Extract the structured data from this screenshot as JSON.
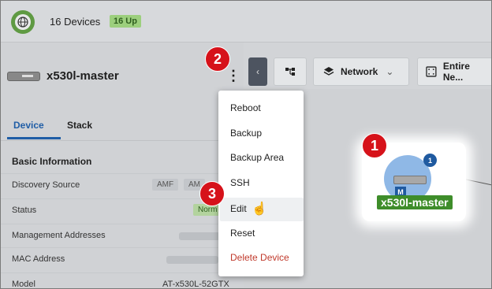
{
  "topbar": {
    "device_count": "16 Devices",
    "up_badge": "16 Up"
  },
  "device_panel": {
    "device_name": "x530l-master",
    "tabs": [
      "Device",
      "Stack"
    ],
    "section_title": "Basic Information",
    "rows": [
      {
        "label": "Discovery Source",
        "chips": [
          "AMF",
          "AM"
        ]
      },
      {
        "label": "Status",
        "chip": "Norm"
      },
      {
        "label": "Management Addresses"
      },
      {
        "label": "MAC Address"
      },
      {
        "label": "Model",
        "value": "AT-x530L-52GTX"
      }
    ]
  },
  "toolbar": {
    "network_label": "Network",
    "entire_label": "Entire Ne..."
  },
  "menu": {
    "items": [
      "Reboot",
      "Backup",
      "Backup Area",
      "SSH",
      "Edit",
      "Reset",
      "Delete Device"
    ],
    "highlighted": "Edit",
    "danger": "Delete Device"
  },
  "node": {
    "label": "x530l-master",
    "badge_count": "1",
    "badge_m": "M"
  },
  "callouts": [
    "1",
    "2",
    "3"
  ],
  "colors": {
    "accent": "#1f5da6",
    "callout": "#d6121a",
    "node_label_bg": "#3e8d2a",
    "danger": "#c0392b"
  },
  "icons": [
    "globe-icon",
    "switch-icon",
    "kebab-menu-icon",
    "chevron-left-icon",
    "topology-icon",
    "layers-icon",
    "chevron-down-icon",
    "scope-icon",
    "hand-cursor-icon"
  ]
}
